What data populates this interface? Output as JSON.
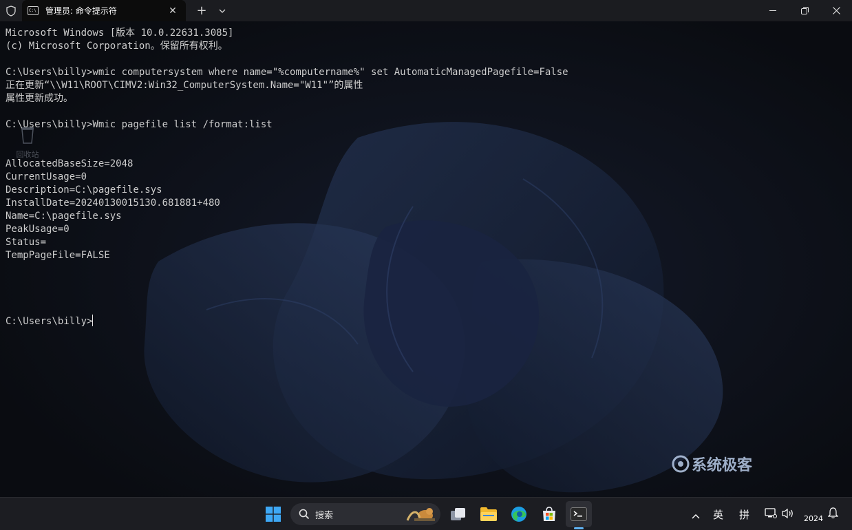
{
  "window": {
    "tab_title": "管理员: 命令提示符",
    "tab_close": "✕",
    "new_tab": "+",
    "dropdown": "⌄"
  },
  "terminal": {
    "lines": [
      "Microsoft Windows [版本 10.0.22631.3085]",
      "(c) Microsoft Corporation。保留所有权利。",
      "",
      "C:\\Users\\billy>wmic computersystem where name=\"%computername%\" set AutomaticManagedPagefile=False",
      "正在更新“\\\\W11\\ROOT\\CIMV2:Win32_ComputerSystem.Name=\"W11\"”的属性",
      "属性更新成功。",
      "",
      "C:\\Users\\billy>Wmic pagefile list /format:list",
      "",
      "",
      "AllocatedBaseSize=2048",
      "CurrentUsage=0",
      "Description=C:\\pagefile.sys",
      "InstallDate=20240130015130.681881+480",
      "Name=C:\\pagefile.sys",
      "PeakUsage=0",
      "Status=",
      "TempPageFile=FALSE",
      "",
      "",
      "",
      "",
      "C:\\Users\\billy>"
    ]
  },
  "desktop": {
    "recycle_bin_label": "回收站"
  },
  "watermark": {
    "text": "系统极客"
  },
  "taskbar": {
    "search_placeholder": "搜索",
    "ime_lang": "英",
    "ime_mode": "拼",
    "clock_year": "2024"
  },
  "colors": {
    "terminal_text": "#cccccc",
    "accent_blue": "#3a8ee6"
  }
}
